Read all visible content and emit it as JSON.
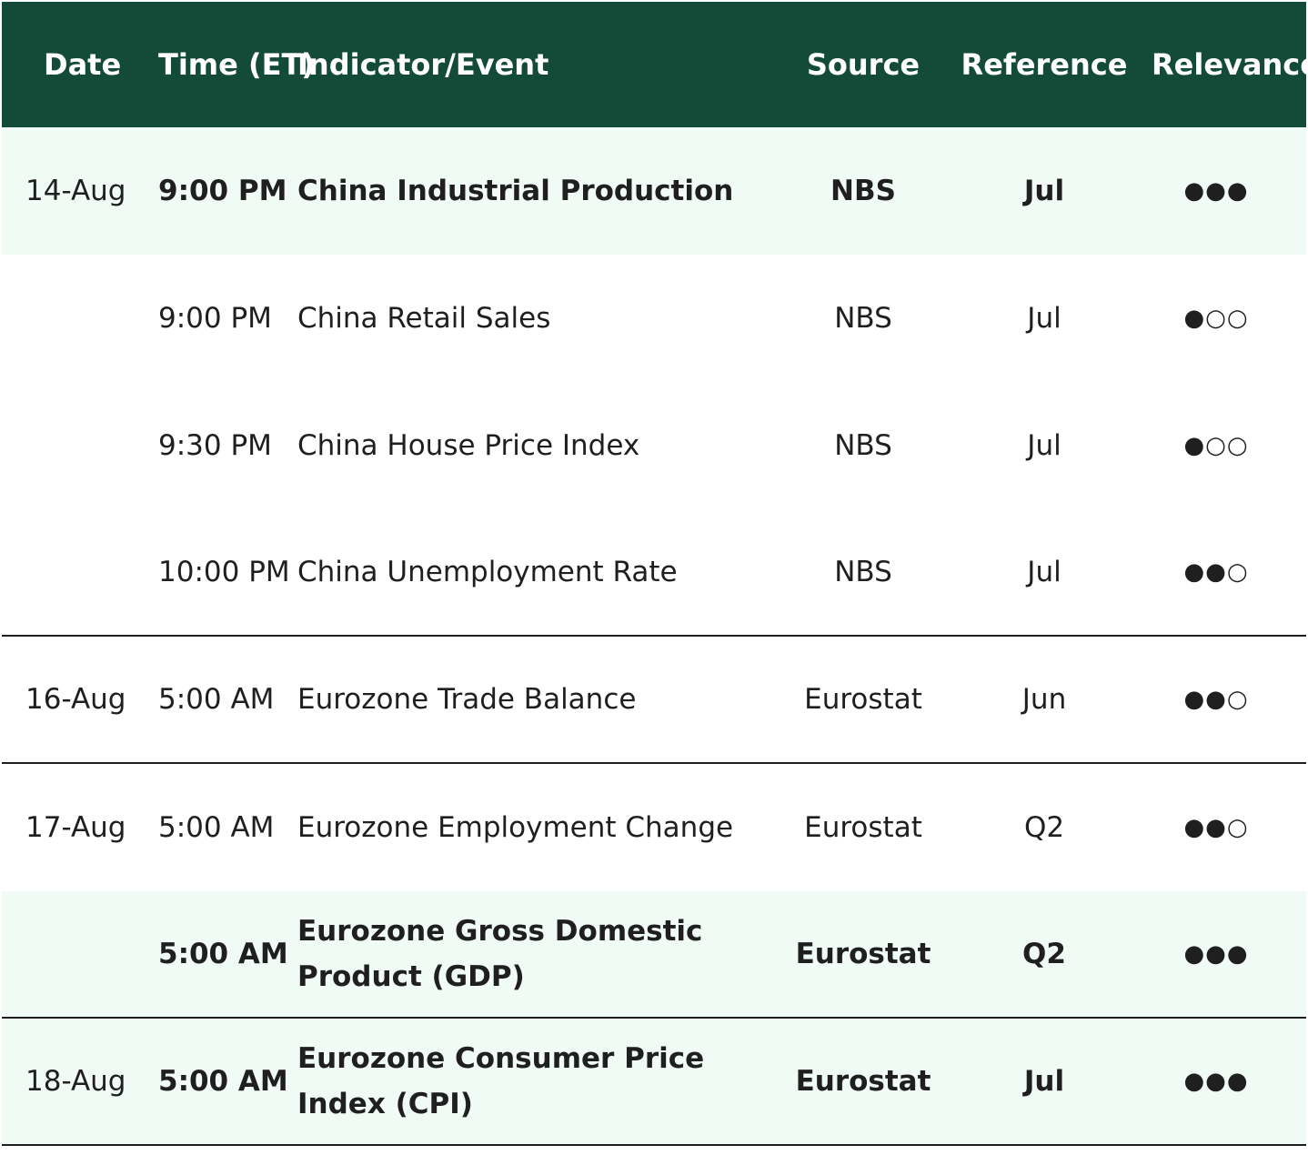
{
  "header": {
    "date": "Date",
    "time": "Time (ET)",
    "event": "Indicator/Event",
    "source": "Source",
    "reference": "Reference",
    "relevance": "Relevance"
  },
  "rows": [
    {
      "date": "14-Aug",
      "time": "9:00 PM",
      "event": "China Industrial Production",
      "source": "NBS",
      "reference": "Jul",
      "relevance": "●●●",
      "relevance_level": 3,
      "bold": true,
      "highlight": true
    },
    {
      "date": "",
      "time": "9:00 PM",
      "event": "China Retail Sales",
      "source": "NBS",
      "reference": "Jul",
      "relevance": "●○○",
      "relevance_level": 1,
      "bold": false,
      "highlight": false
    },
    {
      "date": "",
      "time": "9:30 PM",
      "event": "China House Price Index",
      "source": "NBS",
      "reference": "Jul",
      "relevance": "●○○",
      "relevance_level": 1,
      "bold": false,
      "highlight": false
    },
    {
      "date": "",
      "time": "10:00 PM",
      "event": "China Unemployment Rate",
      "source": "NBS",
      "reference": "Jul",
      "relevance": "●●○",
      "relevance_level": 2,
      "bold": false,
      "highlight": false
    },
    {
      "date": "16-Aug",
      "time": "5:00 AM",
      "event": "Eurozone Trade Balance",
      "source": "Eurostat",
      "reference": "Jun",
      "relevance": "●●○",
      "relevance_level": 2,
      "bold": false,
      "highlight": false
    },
    {
      "date": "17-Aug",
      "time": "5:00 AM",
      "event": "Eurozone Employment Change",
      "source": "Eurostat",
      "reference": "Q2",
      "relevance": "●●○",
      "relevance_level": 2,
      "bold": false,
      "highlight": false
    },
    {
      "date": "",
      "time": "5:00 AM",
      "event": "Eurozone Gross Domestic Product (GDP)",
      "source": "Eurostat",
      "reference": "Q2",
      "relevance": "●●●",
      "relevance_level": 3,
      "bold": true,
      "highlight": true
    },
    {
      "date": "18-Aug",
      "time": "5:00 AM",
      "event": "Eurozone Consumer Price Index (CPI)",
      "source": "Eurostat",
      "reference": "Jul",
      "relevance": "●●●",
      "relevance_level": 3,
      "bold": true,
      "highlight": true
    }
  ],
  "colors": {
    "header_bg": "#134b38",
    "highlight_bg": "#f0fbf6",
    "divider": "#1f1f1f"
  }
}
